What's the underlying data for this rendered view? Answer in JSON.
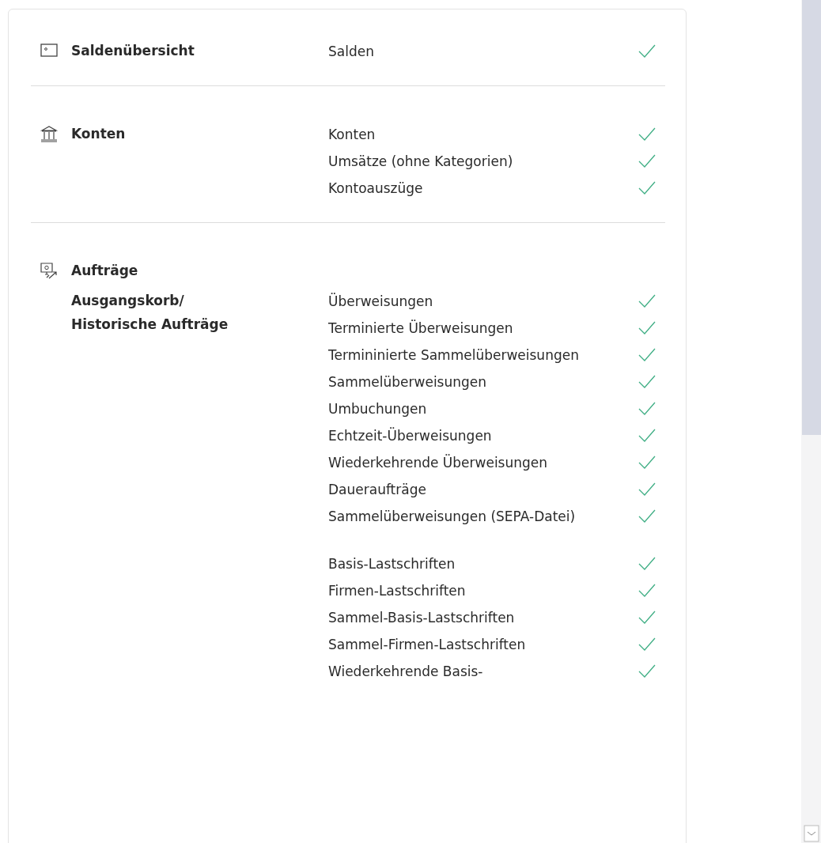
{
  "sections": [
    {
      "title": "Saldenübersicht",
      "kind": "balance",
      "groups": [
        {
          "items": [
            {
              "label": "Salden",
              "checked": true
            }
          ]
        }
      ]
    },
    {
      "title": "Konten",
      "kind": "accounts",
      "groups": [
        {
          "items": [
            {
              "label": "Konten",
              "checked": true
            },
            {
              "label": "Umsätze (ohne Kategorien)",
              "checked": true
            },
            {
              "label": "Kontoauszüge",
              "checked": true
            }
          ]
        }
      ]
    },
    {
      "title": "Aufträge",
      "kind": "orders",
      "groups": [
        {
          "subtitle": "Ausgangskorb/ Historische Aufträge",
          "items": [
            {
              "label": "Überweisungen",
              "checked": true
            },
            {
              "label": "Terminierte Überweisungen",
              "checked": true
            },
            {
              "label": "Termininierte Sammelüberweisungen",
              "checked": true
            },
            {
              "label": "Sammelüberweisungen",
              "checked": true
            },
            {
              "label": "Umbuchungen",
              "checked": true
            },
            {
              "label": "Echtzeit-Überweisungen",
              "checked": true
            },
            {
              "label": "Wiederkehrende Überweisungen",
              "checked": true
            },
            {
              "label": "Daueraufträge",
              "checked": true
            },
            {
              "label": "Sammelüberweisungen (SEPA-Datei)",
              "checked": true
            }
          ]
        },
        {
          "items": [
            {
              "label": "Basis-Lastschriften",
              "checked": true
            },
            {
              "label": "Firmen-Lastschriften",
              "checked": true
            },
            {
              "label": "Sammel-Basis-Lastschriften",
              "checked": true
            },
            {
              "label": "Sammel-Firmen-Lastschriften",
              "checked": true
            },
            {
              "label": "Wiederkehrende Basis-",
              "checked": true
            }
          ]
        }
      ]
    }
  ]
}
